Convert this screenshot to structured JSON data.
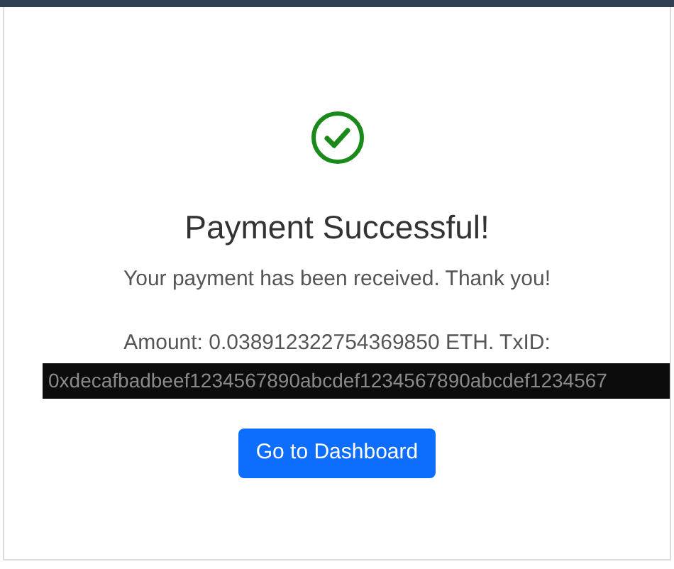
{
  "title": "Payment Successful!",
  "message": "Your payment has been received. Thank you!",
  "amount_line": "Amount: 0.038912322754369850 ETH. TxID:",
  "txid": "0xdecafbadbeef1234567890abcdef1234567890abcdef1234567",
  "button": "Go to Dashboard"
}
